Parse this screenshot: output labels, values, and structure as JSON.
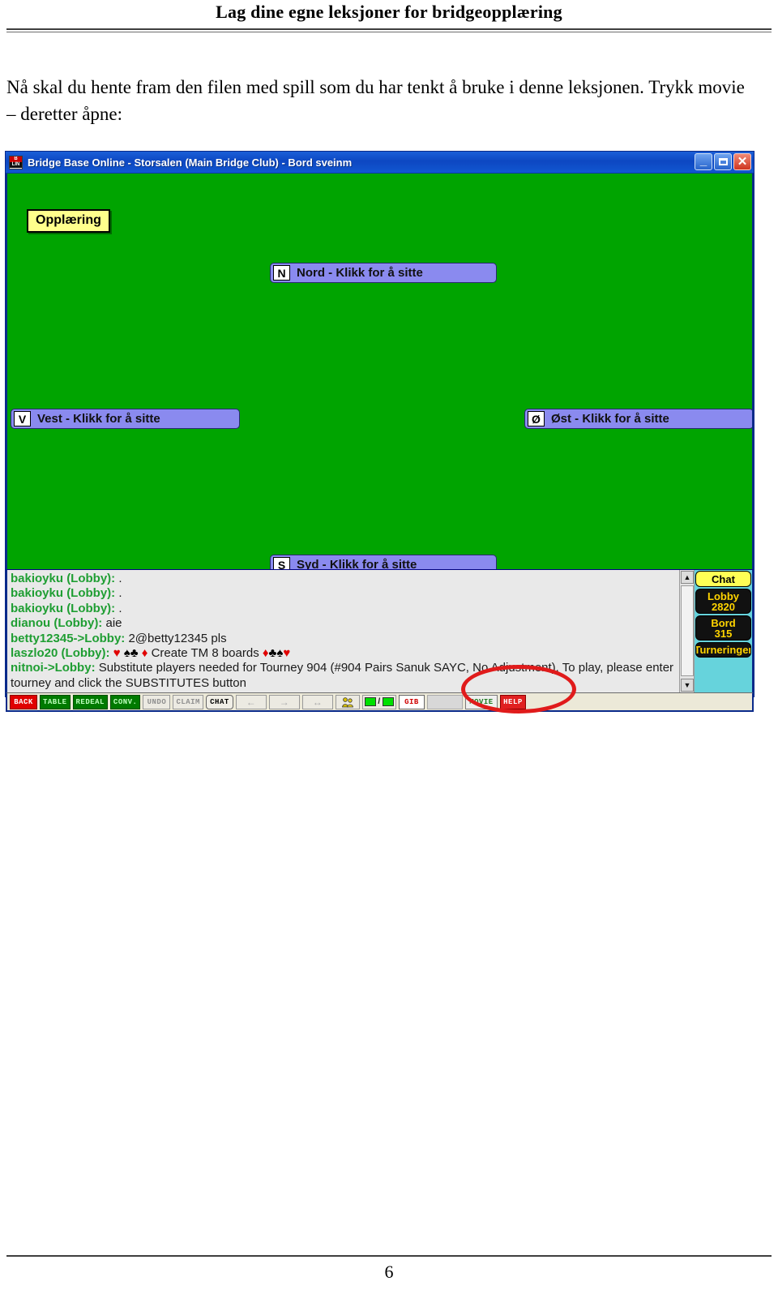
{
  "document": {
    "header_title": "Lag dine egne leksjoner for bridgeopplæring",
    "paragraph": "Nå skal du hente fram den filen med spill som du har tenkt å bruke i denne leksjonen. Trykk movie – deretter åpne:",
    "page_number": "6"
  },
  "app": {
    "title": "Bridge Base Online - Storsalen (Main Bridge Club) - Bord sveinm",
    "window_buttons": {
      "minimize": "_",
      "maximize": "□",
      "close": "✕"
    },
    "table": {
      "lesson_badge": "Opplæring",
      "seats": [
        {
          "badge": "N",
          "label": "Nord - Klikk for å sitte"
        },
        {
          "badge": "V",
          "label": "Vest - Klikk for å sitte"
        },
        {
          "badge": "Ø",
          "label": "Øst - Klikk for å sitte"
        },
        {
          "badge": "S",
          "label": "Syd - Klikk for å sitte"
        }
      ]
    },
    "chat": {
      "lines": [
        {
          "who": "bakioyku (Lobby):",
          "msg": " ."
        },
        {
          "who": "bakioyku (Lobby):",
          "msg": " ."
        },
        {
          "who": "bakioyku (Lobby):",
          "msg": " ."
        },
        {
          "who": "dianou (Lobby):",
          "msg": " aie"
        },
        {
          "who": "betty12345->Lobby:",
          "msg": " 2@betty12345 pls"
        },
        {
          "who": "laszlo20 (Lobby):",
          "msg": " ♥ ♠♣ ♦ Create TM 8 boards ♦♣♠♥"
        },
        {
          "who": "nitnoi->Lobby:",
          "msg": " Substitute players needed for Tourney 904 (#904 Pairs Sanuk SAYC, No Adjustment). To play, please enter tourney and click the SUBSTITUTES button"
        }
      ],
      "scrollbar": {
        "up": "▲",
        "down": "▼"
      }
    },
    "side_panel": {
      "chat": "Chat",
      "lobby_label": "Lobby",
      "lobby_count": "2820",
      "bord_label": "Bord",
      "bord_count": "315",
      "tourneys": "Turneringer"
    },
    "toolbar": [
      {
        "label": "BACK",
        "style": "red"
      },
      {
        "label": "TABLE",
        "style": "green"
      },
      {
        "label": "REDEAL",
        "style": "green"
      },
      {
        "label": "CONV.",
        "style": "green"
      },
      {
        "label": "UNDO",
        "style": "dim"
      },
      {
        "label": "CLAIM",
        "style": "dim"
      },
      {
        "label": "CHAT",
        "style": "chatb"
      },
      {
        "label": "←",
        "style": "arrow"
      },
      {
        "label": "→",
        "style": "arrow"
      },
      {
        "label": "↔",
        "style": "arrow"
      },
      {
        "label": "",
        "style": "icon"
      },
      {
        "label": "/",
        "style": "swap"
      },
      {
        "label": "GIB",
        "style": "gib"
      },
      {
        "label": "",
        "style": "blank"
      },
      {
        "label": "MOVIE",
        "style": "movie"
      },
      {
        "label": "HELP",
        "style": "help"
      }
    ]
  },
  "annotation": {
    "shape": "red-ellipse",
    "color": "#e01b1b",
    "target": "MOVIE"
  }
}
